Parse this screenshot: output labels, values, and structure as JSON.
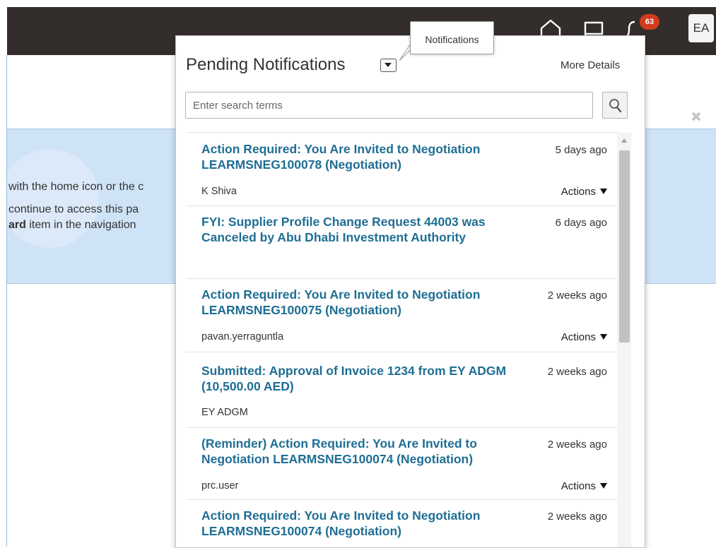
{
  "header": {
    "icons": [
      "home-icon",
      "flag-icon",
      "bell-icon"
    ],
    "notification_count": "63",
    "user_initials": "EA"
  },
  "tooltip": {
    "text": "Notifications"
  },
  "background": {
    "lines": [
      "with the home icon or the c",
      "continue to access this pa",
      "item in the navigation"
    ],
    "bold_fragment": "ard"
  },
  "popup": {
    "title": "Pending Notifications",
    "more_details": "More Details",
    "search": {
      "placeholder": "Enter search terms",
      "value": ""
    },
    "actions_label": "Actions",
    "notifications": [
      {
        "title": "Action Required: You Are Invited to Negotiation LEARMSNEG100078 (Negotiation)",
        "time": "5 days ago",
        "sender": "K Shiva",
        "has_actions": true
      },
      {
        "title": "FYI: Supplier Profile Change Request 44003 was Canceled by Abu Dhabi Investment Authority",
        "time": "6 days ago",
        "sender": "",
        "has_actions": false
      },
      {
        "title": "Action Required: You Are Invited to Negotiation LEARMSNEG100075 (Negotiation)",
        "time": "2 weeks ago",
        "sender": "pavan.yerraguntla",
        "has_actions": true
      },
      {
        "title": "Submitted: Approval of Invoice 1234 from EY ADGM (10,500.00 AED)",
        "time": "2 weeks ago",
        "sender": "EY ADGM",
        "has_actions": false
      },
      {
        "title": "(Reminder) Action Required: You Are Invited to Negotiation LEARMSNEG100074 (Negotiation)",
        "time": "2 weeks ago",
        "sender": "prc.user",
        "has_actions": true
      },
      {
        "title": "Action Required: You Are Invited to Negotiation LEARMSNEG100074 (Negotiation)",
        "time": "2 weeks ago",
        "sender": "",
        "has_actions": false
      }
    ]
  },
  "colors": {
    "topbar": "#332e2c",
    "badge": "#d43a1d",
    "link": "#1f6e94",
    "banner": "#cfe3f7"
  }
}
